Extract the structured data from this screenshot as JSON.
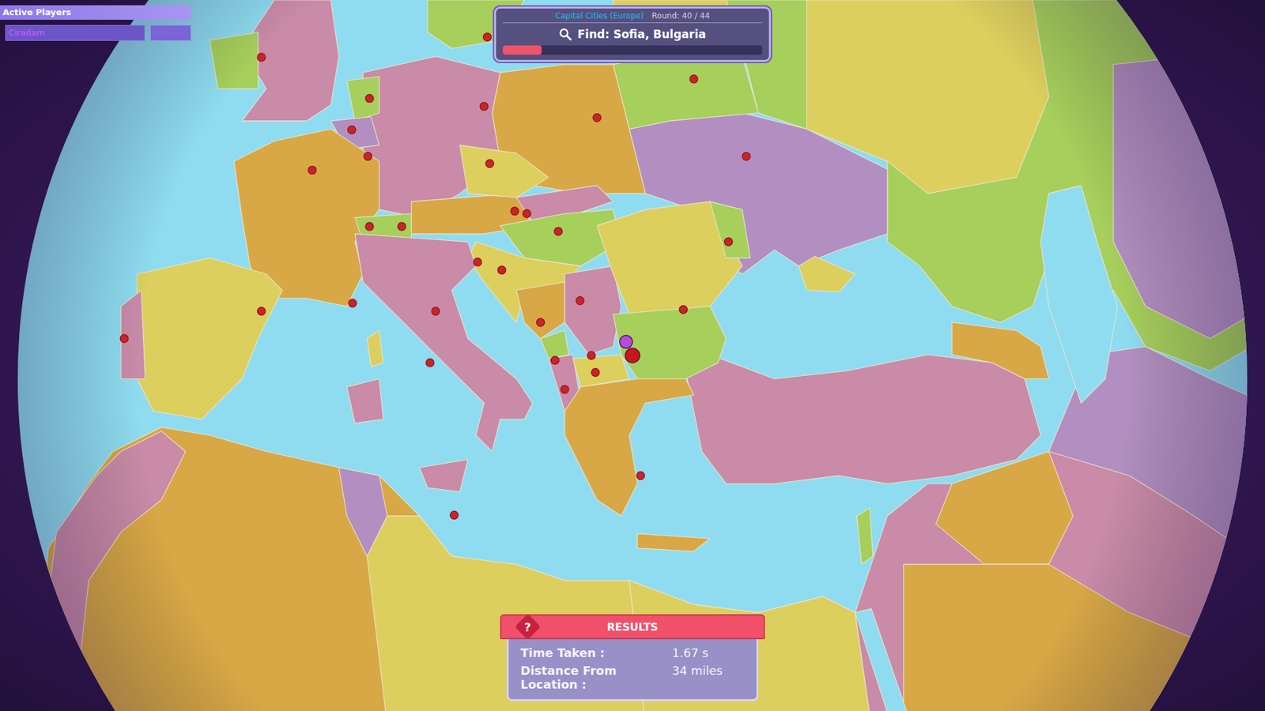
{
  "players_panel": {
    "title": "Active Players",
    "players": [
      {
        "name": "Ciradam"
      }
    ]
  },
  "round": {
    "mode": "Capital Cities (Europe)",
    "round": "Round: 40 / 44",
    "prompt": "Find: Sofia, Bulgaria",
    "timer": {
      "level": 0.15
    }
  },
  "map": {
    "markers": [
      {
        "kind": "guess",
        "color": "#b04ee0"
      },
      {
        "kind": "answer",
        "color": "#c8161d"
      }
    ]
  },
  "results": {
    "icon": "?",
    "title": "RESULTS",
    "rows": [
      {
        "label": "Time Taken :",
        "value": "1.67 s"
      },
      {
        "label": "Distance From Location :",
        "value": "34 miles"
      }
    ]
  }
}
